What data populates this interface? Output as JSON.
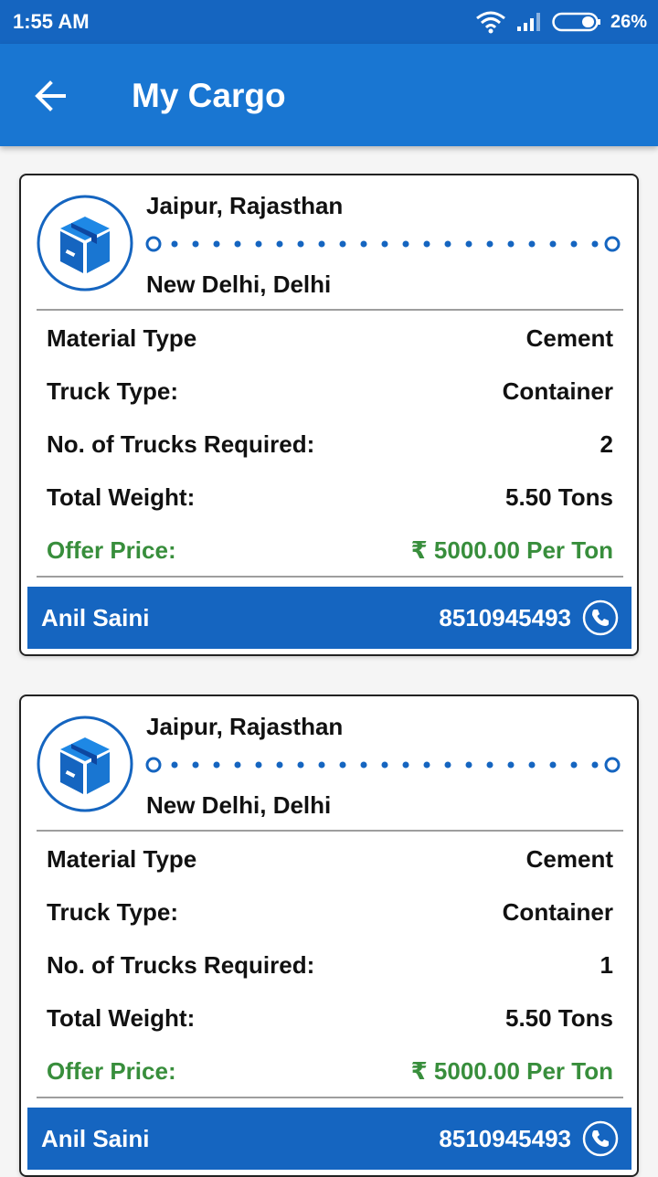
{
  "status_bar": {
    "time": "1:55 AM",
    "battery_percent": "26%",
    "icons": [
      "wifi-icon",
      "signal-icon",
      "battery-icon"
    ]
  },
  "app_bar": {
    "title": "My Cargo",
    "back_icon": "arrow-back-icon"
  },
  "colors": {
    "status_bar": "#1565c0",
    "app_bar": "#1976d2",
    "accent_blue": "#1565c0",
    "offer_green": "#388e3c"
  },
  "cargo_list": [
    {
      "origin": "Jaipur, Rajasthan",
      "destination": "New Delhi, Delhi",
      "material_type_label": "Material Type",
      "material_type": "Cement",
      "truck_type_label": "Truck Type:",
      "truck_type": "Container",
      "trucks_required_label": "No. of Trucks Required:",
      "trucks_required": "2",
      "total_weight_label": "Total Weight:",
      "total_weight": "5.50 Tons",
      "offer_price_label": "Offer Price:",
      "offer_price": "₹ 5000.00 Per Ton",
      "contact_name": "Anil Saini",
      "contact_phone": "8510945493"
    },
    {
      "origin": "Jaipur, Rajasthan",
      "destination": "New Delhi, Delhi",
      "material_type_label": "Material Type",
      "material_type": "Cement",
      "truck_type_label": "Truck Type:",
      "truck_type": "Container",
      "trucks_required_label": "No. of Trucks Required:",
      "trucks_required": "1",
      "total_weight_label": "Total Weight:",
      "total_weight": "5.50 Tons",
      "offer_price_label": "Offer Price:",
      "offer_price": "₹ 5000.00 Per Ton",
      "contact_name": "Anil Saini",
      "contact_phone": "8510945493"
    }
  ]
}
